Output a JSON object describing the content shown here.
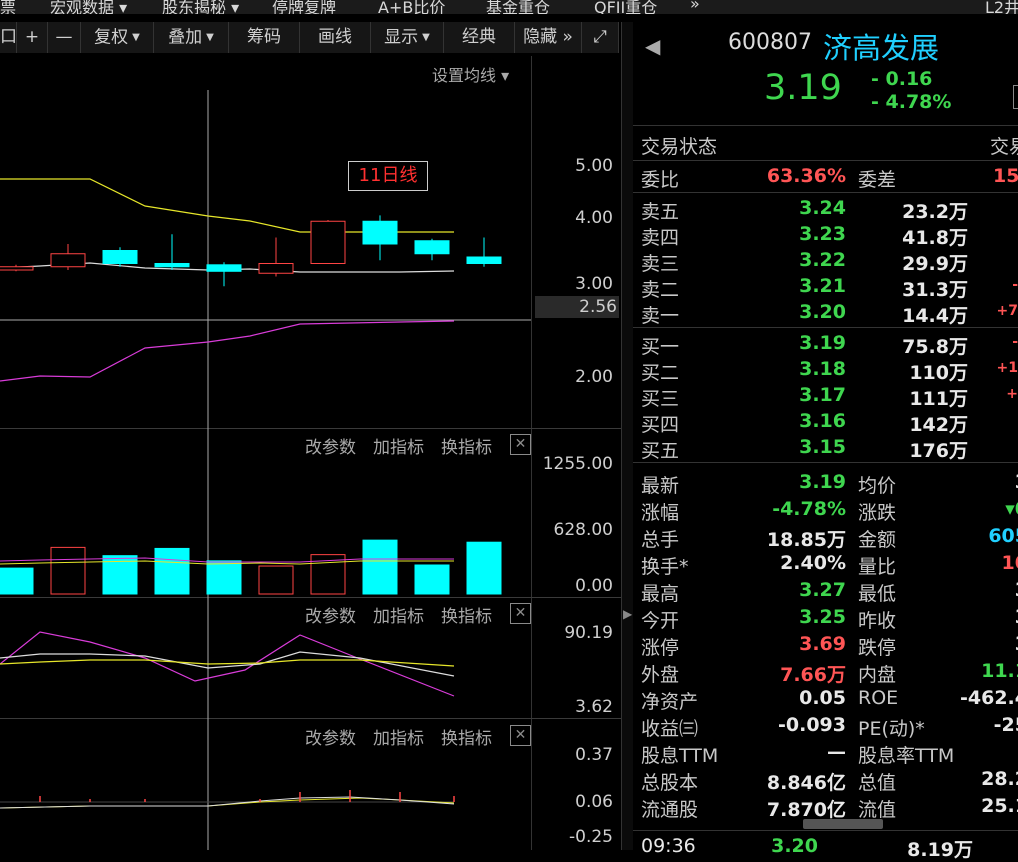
{
  "menu": [
    "票",
    "宏观数据 ▾",
    "股东揭秘 ▾",
    "停牌复牌",
    "A+B比价",
    "基金重仓",
    "QFII重仓",
    "»",
    "L2井"
  ],
  "toolbar": {
    "items": [
      {
        "label": "口"
      },
      {
        "label": "+"
      },
      {
        "label": "—"
      },
      {
        "label": "复权",
        "dropdown": true
      },
      {
        "label": "叠加",
        "dropdown": true
      },
      {
        "label": "筹码"
      },
      {
        "label": "画线"
      },
      {
        "label": "显示",
        "dropdown": true
      },
      {
        "label": "经典"
      },
      {
        "label": "隐藏 »"
      },
      {
        "label": "⤢"
      }
    ]
  },
  "main_chart": {
    "ma_setting": "设置均线 ▾",
    "tooltip": "11日线",
    "price_labels": [
      "5.00",
      "4.00",
      "3.00",
      "2.56",
      "2.00"
    ],
    "candles": [
      {
        "o": 3.25,
        "c": 3.2,
        "h": 3.28,
        "l": 3.18,
        "up": true
      },
      {
        "o": 3.25,
        "c": 3.45,
        "h": 3.6,
        "l": 3.2,
        "up": true
      },
      {
        "o": 3.5,
        "c": 3.3,
        "h": 3.55,
        "l": 3.25,
        "up": false
      },
      {
        "o": 3.3,
        "c": 3.25,
        "h": 3.75,
        "l": 3.2,
        "up": false
      },
      {
        "o": 3.28,
        "c": 3.18,
        "h": 3.32,
        "l": 2.95,
        "up": false
      },
      {
        "o": 3.15,
        "c": 3.3,
        "h": 3.7,
        "l": 3.1,
        "up": true
      },
      {
        "o": 3.3,
        "c": 3.95,
        "h": 3.97,
        "l": 3.3,
        "up": true
      },
      {
        "o": 3.95,
        "c": 3.6,
        "h": 4.05,
        "l": 3.35,
        "up": false
      },
      {
        "o": 3.65,
        "c": 3.45,
        "h": 3.68,
        "l": 3.35,
        "up": false
      },
      {
        "o": 3.4,
        "c": 3.3,
        "h": 3.7,
        "l": 3.25,
        "up": false
      }
    ]
  },
  "volume_panel": {
    "buttons": [
      "改参数",
      "加指标",
      "换指标"
    ],
    "labels": [
      "1255.00",
      "628.00",
      "0.00"
    ],
    "bars": [
      {
        "v": 250,
        "up": false
      },
      {
        "v": 450,
        "up": true
      },
      {
        "v": 370,
        "up": false
      },
      {
        "v": 440,
        "up": false
      },
      {
        "v": 320,
        "up": false
      },
      {
        "v": 270,
        "up": true
      },
      {
        "v": 380,
        "up": true
      },
      {
        "v": 520,
        "up": false
      },
      {
        "v": 280,
        "up": false
      },
      {
        "v": 500,
        "up": false
      }
    ]
  },
  "kdj_panel": {
    "buttons": [
      "改参数",
      "加指标",
      "换指标"
    ],
    "labels": [
      "90.19",
      "3.62"
    ]
  },
  "macd_panel": {
    "buttons": [
      "改参数",
      "加指标",
      "换指标"
    ],
    "labels": [
      "0.37",
      "0.06",
      "-0.25"
    ]
  },
  "quote": {
    "code": "600807",
    "name": "济高发展",
    "price": "3.19",
    "change": "- 0.16",
    "change_pct": "- 4.78%",
    "trade_status_label": "交易状态",
    "trade_status_right": "交易",
    "weibi_label": "委比",
    "weibi": "63.36%",
    "weicha_label": "委差",
    "weicha": "15",
    "asks": [
      {
        "label": "卖五",
        "price": "3.24",
        "vol": "23.2万",
        "extra": ""
      },
      {
        "label": "卖四",
        "price": "3.23",
        "vol": "41.8万",
        "extra": ""
      },
      {
        "label": "卖三",
        "price": "3.22",
        "vol": "29.9万",
        "extra": ""
      },
      {
        "label": "卖二",
        "price": "3.21",
        "vol": "31.3万",
        "extra": "-"
      },
      {
        "label": "卖一",
        "price": "3.20",
        "vol": "14.4万",
        "extra": "+7"
      }
    ],
    "bids": [
      {
        "label": "买一",
        "price": "3.19",
        "vol": "75.8万",
        "extra": "-"
      },
      {
        "label": "买二",
        "price": "3.18",
        "vol": "110万",
        "extra": "+1"
      },
      {
        "label": "买三",
        "price": "3.17",
        "vol": "111万",
        "extra": "+"
      },
      {
        "label": "买四",
        "price": "3.16",
        "vol": "142万",
        "extra": ""
      },
      {
        "label": "买五",
        "price": "3.15",
        "vol": "176万",
        "extra": ""
      }
    ],
    "stats": [
      {
        "l1": "最新",
        "v1": "3.19",
        "c1": "g",
        "l2": "均价",
        "v2": "3",
        "c2": "w"
      },
      {
        "l1": "涨幅",
        "v1": "-4.78%",
        "c1": "g",
        "l2": "涨跌",
        "v2": "▾0",
        "c2": "g"
      },
      {
        "l1": "总手",
        "v1": "18.85万",
        "c1": "w",
        "l2": "金额",
        "v2": "605",
        "c2": "c"
      },
      {
        "l1": "换手*",
        "v1": "2.40%",
        "c1": "w",
        "l2": "量比",
        "v2": "10",
        "c2": "r"
      },
      {
        "l1": "最高",
        "v1": "3.27",
        "c1": "g",
        "l2": "最低",
        "v2": "3",
        "c2": "w"
      },
      {
        "l1": "今开",
        "v1": "3.25",
        "c1": "g",
        "l2": "昨收",
        "v2": "3",
        "c2": "w"
      },
      {
        "l1": "涨停",
        "v1": "3.69",
        "c1": "r",
        "l2": "跌停",
        "v2": "3",
        "c2": "w"
      },
      {
        "l1": "外盘",
        "v1": "7.66万",
        "c1": "r",
        "l2": "内盘",
        "v2": "11.1",
        "c2": "g"
      },
      {
        "l1": "净资产",
        "v1": "0.05",
        "c1": "w",
        "l2": "ROE",
        "v2": "-462.4",
        "c2": "w"
      },
      {
        "l1": "收益㈢",
        "v1": "-0.093",
        "c1": "w",
        "l2": "PE(动)*",
        "v2": "-25",
        "c2": "w"
      },
      {
        "l1": "股息TTM",
        "v1": "—",
        "c1": "w",
        "l2": "股息率TTM",
        "v2": "",
        "c2": "w"
      },
      {
        "l1": "总股本",
        "v1": "8.846亿",
        "c1": "w",
        "l2": "总值",
        "v2": "28.2",
        "c2": "w"
      },
      {
        "l1": "流通股",
        "v1": "7.870亿",
        "c1": "w",
        "l2": "流值",
        "v2": "25.1",
        "c2": "w"
      }
    ],
    "tick_time": "09:36",
    "tick_price": "3.20",
    "tick_vol": "8.19万"
  },
  "colors": {
    "up": "#ff4444",
    "down": "#00ffff",
    "ma_yellow": "#e6e62a",
    "ma_white": "#dddddd",
    "ma_magenta": "#d93cd9",
    "green": "#3fd64f",
    "red": "#ff5555",
    "cyan": "#20d0ff"
  }
}
